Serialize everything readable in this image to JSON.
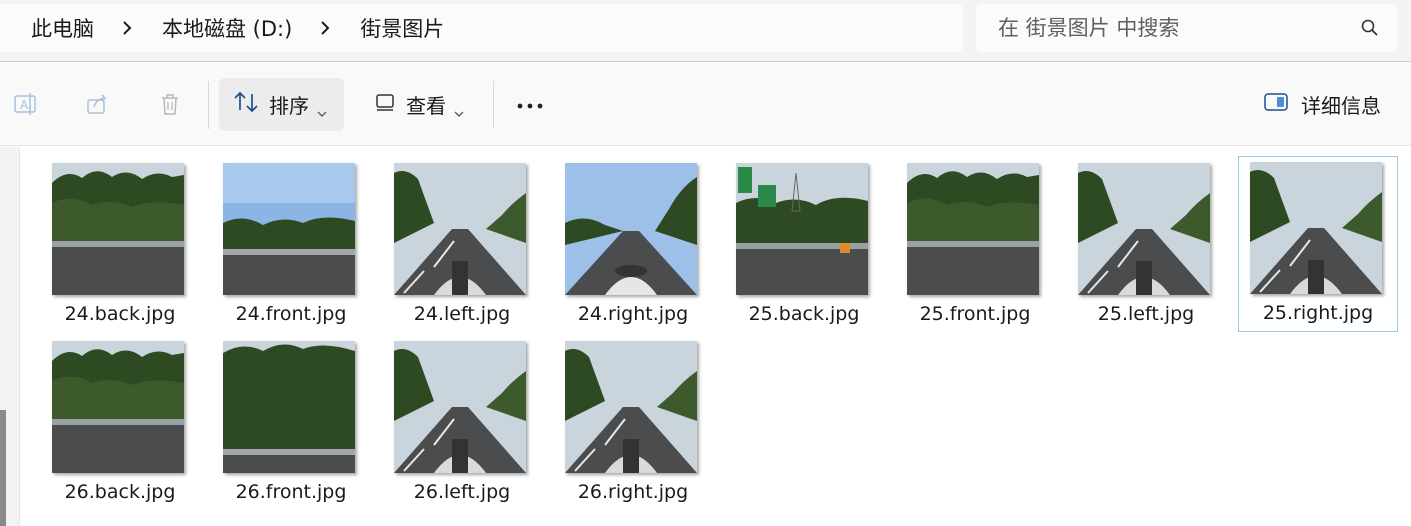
{
  "breadcrumb": {
    "items": [
      "此电脑",
      "本地磁盘 (D:)",
      "街景图片"
    ]
  },
  "search": {
    "placeholder": "在 街景图片 中搜索"
  },
  "toolbar": {
    "sort_label": "排序",
    "view_label": "查看",
    "details_label": "详细信息"
  },
  "files": [
    {
      "name": "24.back.jpg",
      "scene": "back"
    },
    {
      "name": "24.front.jpg",
      "scene": "front"
    },
    {
      "name": "24.left.jpg",
      "scene": "road"
    },
    {
      "name": "24.right.jpg",
      "scene": "road"
    },
    {
      "name": "25.back.jpg",
      "scene": "sign"
    },
    {
      "name": "25.front.jpg",
      "scene": "back"
    },
    {
      "name": "25.left.jpg",
      "scene": "road"
    },
    {
      "name": "25.right.jpg",
      "scene": "road",
      "selected": true
    },
    {
      "name": "26.back.jpg",
      "scene": "back"
    },
    {
      "name": "26.front.jpg",
      "scene": "front"
    },
    {
      "name": "26.left.jpg",
      "scene": "road"
    },
    {
      "name": "26.right.jpg",
      "scene": "road"
    }
  ],
  "colors": {
    "sky": "#c9d4dc",
    "trees": "#2e4a22",
    "road": "#4a4c4e",
    "selection": "#9fc9e0"
  }
}
